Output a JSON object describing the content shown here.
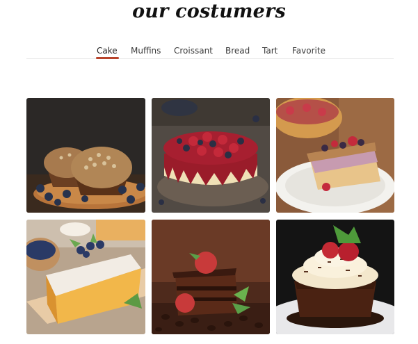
{
  "heading": "our costumers",
  "tabs": [
    {
      "label": "Cake",
      "active": true
    },
    {
      "label": "Muffins",
      "active": false
    },
    {
      "label": "Croissant",
      "active": false
    },
    {
      "label": "Bread",
      "active": false
    },
    {
      "label": "Tart",
      "active": false
    },
    {
      "label": "Favorite",
      "active": false
    }
  ],
  "accent_color": "#b8442c",
  "gallery": [
    {
      "subject": "muffins with blueberries",
      "icon": "muffin-photo"
    },
    {
      "subject": "berry cheesecake",
      "icon": "cheesecake-photo"
    },
    {
      "subject": "berry crumble tart slice",
      "icon": "tart-slice-photo"
    },
    {
      "subject": "pound cake with blueberries",
      "icon": "pound-cake-photo"
    },
    {
      "subject": "chocolate layer cake with strawberries",
      "icon": "chocolate-cake-photo"
    },
    {
      "subject": "chocolate cupcake with cream and strawberry",
      "icon": "cupcake-photo"
    }
  ]
}
